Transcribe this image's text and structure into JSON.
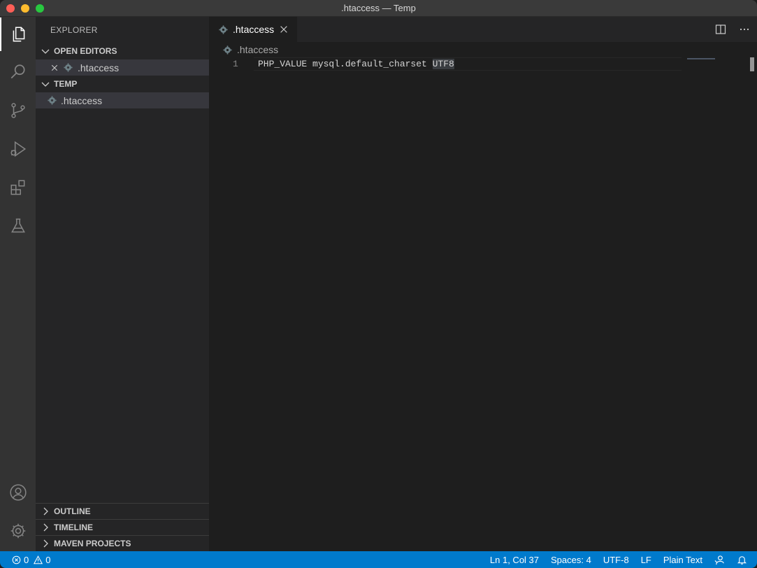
{
  "window": {
    "title": ".htaccess — Temp"
  },
  "sidebar": {
    "header": "EXPLORER",
    "open_editors": {
      "title": "OPEN EDITORS",
      "items": [
        {
          "label": ".htaccess"
        }
      ]
    },
    "folder": {
      "title": "TEMP",
      "items": [
        {
          "label": ".htaccess"
        }
      ]
    },
    "collapsed_sections": [
      {
        "title": "OUTLINE"
      },
      {
        "title": "TIMELINE"
      },
      {
        "title": "MAVEN PROJECTS"
      }
    ]
  },
  "editor": {
    "tab": {
      "label": ".htaccess"
    },
    "breadcrumb": ".htaccess",
    "lines": [
      {
        "number": "1",
        "text_before": "PHP_VALUE mysql.default_charset ",
        "text_selected": "UTF8"
      }
    ]
  },
  "statusbar": {
    "errors": "0",
    "warnings": "0",
    "cursor": "Ln 1, Col 37",
    "indent": "Spaces: 4",
    "encoding": "UTF-8",
    "eol": "LF",
    "language": "Plain Text"
  },
  "colors": {
    "accent": "#007acc",
    "activity_bar": "#333333",
    "sidebar": "#252526",
    "editor": "#1e1e1e"
  },
  "icons": [
    "files-icon",
    "search-icon",
    "source-control-icon",
    "run-debug-icon",
    "extensions-icon",
    "testing-flask-icon",
    "account-icon",
    "manage-gear-icon",
    "gear-file-icon",
    "close-icon",
    "chevron-down-icon",
    "chevron-right-icon",
    "split-editor-icon",
    "more-actions-icon",
    "error-icon",
    "warning-icon",
    "feedback-icon",
    "bell-icon"
  ]
}
